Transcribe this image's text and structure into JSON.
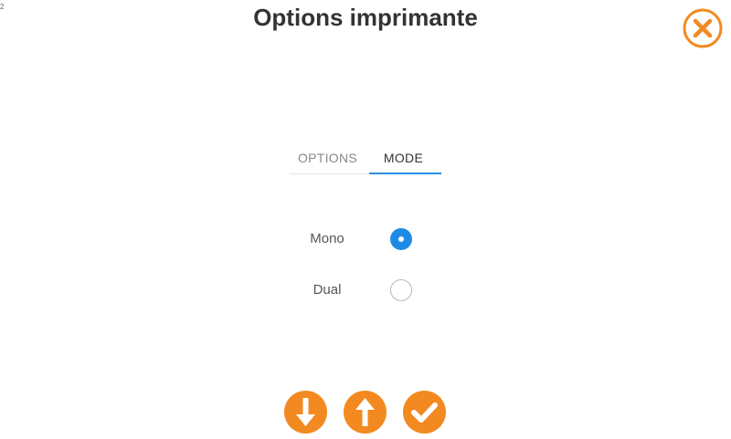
{
  "page": {
    "corner_mark": "2",
    "title": "Options imprimante"
  },
  "close_icon": "close-icon",
  "tabs": [
    {
      "label": "OPTIONS",
      "active": false
    },
    {
      "label": "MODE",
      "active": true
    }
  ],
  "mode_options": [
    {
      "label": "Mono",
      "selected": true
    },
    {
      "label": "Dual",
      "selected": false
    }
  ],
  "actions": [
    {
      "icon": "arrow-down-icon"
    },
    {
      "icon": "arrow-up-icon"
    },
    {
      "icon": "checkmark-icon"
    }
  ],
  "colors": {
    "accent_orange": "#f28a21",
    "accent_blue": "#1f8ae6",
    "title_text": "#333333"
  }
}
